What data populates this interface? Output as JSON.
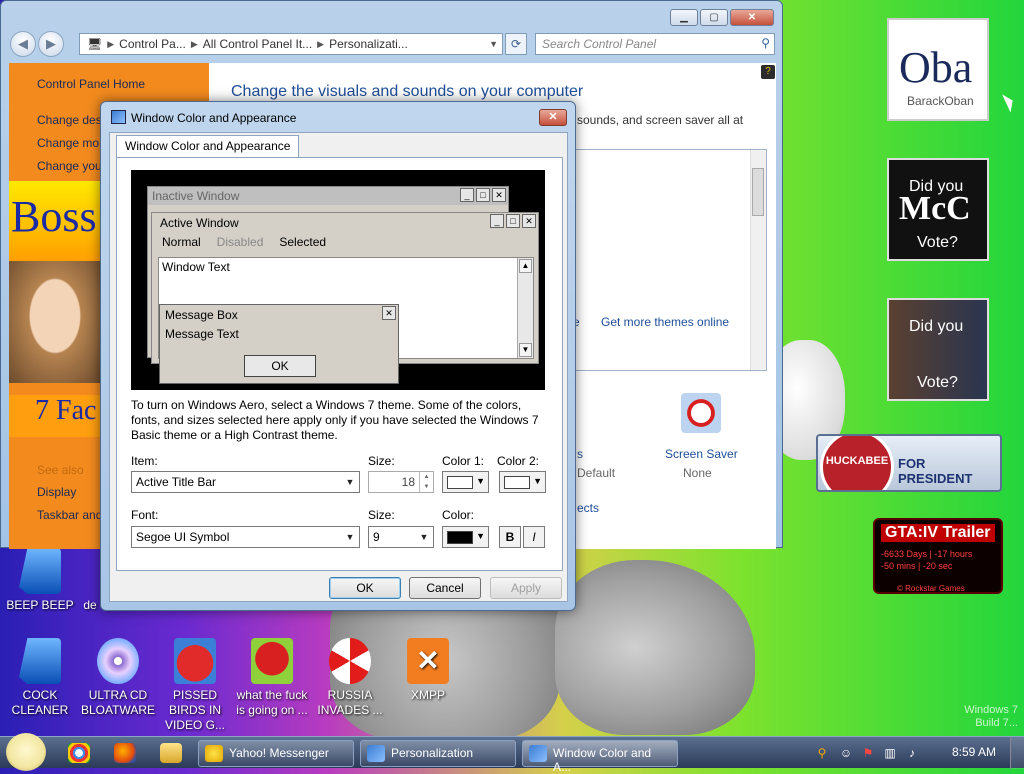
{
  "desktop": {
    "icons": [
      {
        "label": "BEEP BEEP",
        "icon": "phone-icon"
      },
      {
        "label": "de",
        "icon": "unknown-icon"
      },
      {
        "label": "COCK CLEANER",
        "icon": "cleaner-icon"
      },
      {
        "label": "ULTRA CD BLOATWARE",
        "icon": "cd-icon"
      },
      {
        "label": "PISSED BIRDS IN VIDEO G...",
        "icon": "bird-icon"
      },
      {
        "label": "what the fuck is going on ...",
        "icon": "bird-pirate-icon"
      },
      {
        "label": "RUSSIA INVADES ...",
        "icon": "radiation-icon"
      },
      {
        "label": "XMPP",
        "icon": "xampp-icon"
      }
    ],
    "gadgets": {
      "obama_big": "Oba",
      "obama_small": "BarackOban",
      "mccain_line1": "Did you",
      "mccain_big": "McC",
      "mccain_line2": "Vote?",
      "hillary_line1": "Did you",
      "hillary_line2": "Vote?",
      "huckabee": "HUCKABEE",
      "huckabee_sub": "FOR PRESIDENT",
      "gta_title": "GTA:IV Trailer",
      "gta_line1": "-6633 Days | -17 hours",
      "gta_line2": "-50 mins | -20 sec",
      "gta_footer": "© Rockstar Games"
    },
    "watermark_1": "Windows 7",
    "watermark_2": "Build 7..."
  },
  "personalization": {
    "address": [
      "Control Pa...",
      "All Control Panel It...",
      "Personalizati..."
    ],
    "search_placeholder": "Search Control Panel",
    "sidebar": {
      "home": "Control Panel Home",
      "link1": "Change des",
      "link2": "Change mo",
      "link3": "Change you",
      "boss": "Boss",
      "seven": "7 Fac",
      "see_also": "See also",
      "display": "Display",
      "taskbar": "Taskbar and"
    },
    "title": "Change the visuals and sounds on your computer",
    "subtitle": "sounds, and screen saver all at",
    "link_e": "e",
    "get_more_themes": "Get more themes online",
    "sounds_label": "s",
    "sounds_value": "Default",
    "screen_saver_label": "Screen Saver",
    "screen_saver_value": "None",
    "cts": "ects"
  },
  "dialog": {
    "title": "Window Color and Appearance",
    "tab": "Window Color and Appearance",
    "preview": {
      "inactive_window": "Inactive Window",
      "active_window": "Active Window",
      "menu_normal": "Normal",
      "menu_disabled": "Disabled",
      "menu_selected": "Selected",
      "window_text": "Window Text",
      "message_box": "Message Box",
      "message_text": "Message Text",
      "ok": "OK"
    },
    "description": "To turn on Windows Aero, select a Windows 7 theme.  Some of the colors, fonts, and sizes selected here apply only if you have selected the Windows 7 Basic theme or a High Contrast theme.",
    "item_label": "Item:",
    "item_value": "Active Title Bar",
    "size_label": "Size:",
    "size_value": "18",
    "color1_label": "Color 1:",
    "color2_label": "Color 2:",
    "font_label": "Font:",
    "font_value": "Segoe UI Symbol",
    "font_size_label": "Size:",
    "font_size_value": "9",
    "color_label": "Color:",
    "bold": "B",
    "italic": "I",
    "ok": "OK",
    "cancel": "Cancel",
    "apply": "Apply"
  },
  "taskbar": {
    "tasks": [
      "Yahoo! Messenger",
      "Personalization",
      "Window Color and A..."
    ],
    "clock": "8:59 AM"
  },
  "colors": {
    "accent_link": "#1e4e9a",
    "sidebar_orange": "#f28a1e",
    "color1_swatch": "#ffffff",
    "color2_swatch": "#ffffff",
    "font_color_swatch": "#000000"
  }
}
